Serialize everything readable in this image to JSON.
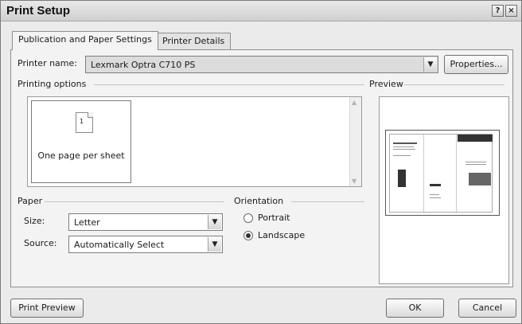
{
  "window": {
    "title": "Print Setup",
    "help_glyph": "?",
    "close_glyph": "×"
  },
  "tabs": [
    "Publication and Paper Settings",
    "Printer Details"
  ],
  "printer": {
    "label": "Printer name:",
    "value": "Lexmark Optra C710 PS",
    "properties_label": "Properties..."
  },
  "printing_options": {
    "label": "Printing options",
    "page_number": "1",
    "option_label": "One page per sheet"
  },
  "preview": {
    "label": "Preview"
  },
  "paper": {
    "label": "Paper",
    "size_label": "Size:",
    "size_value": "Letter",
    "source_label": "Source:",
    "source_value": "Automatically Select"
  },
  "orientation": {
    "label": "Orientation",
    "portrait_label": "Portrait",
    "landscape_label": "Landscape",
    "selected": "Landscape"
  },
  "footer": {
    "print_preview_label": "Print Preview",
    "ok_label": "OK",
    "cancel_label": "Cancel"
  },
  "icons": {
    "dropdown": "chevron-down-icon",
    "scroll_up": "arrow-up-icon",
    "scroll_down": "arrow-down-icon",
    "page": "page-icon"
  }
}
